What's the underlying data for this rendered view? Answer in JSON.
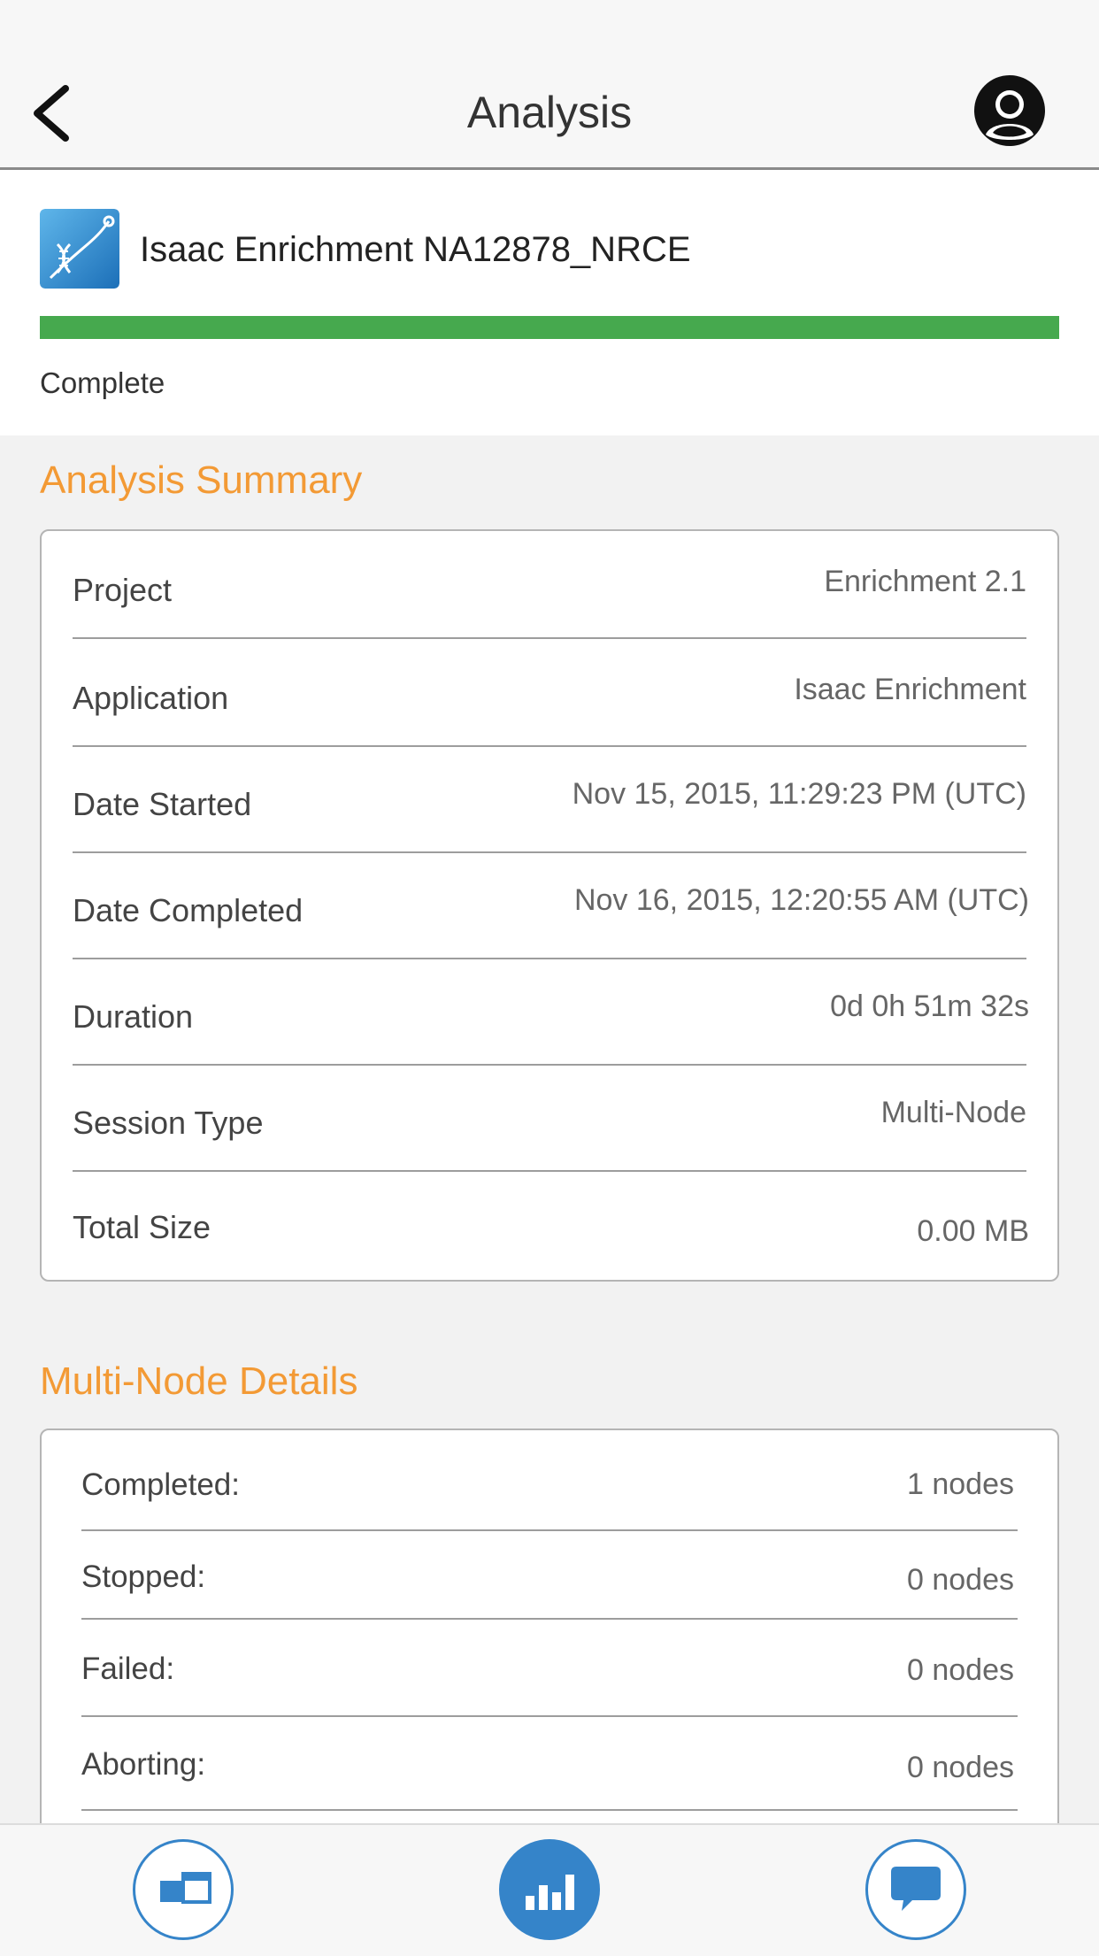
{
  "header": {
    "title": "Analysis",
    "back_icon": "chevron-left-icon",
    "avatar_icon": "user-avatar-icon"
  },
  "analysis": {
    "name": "Isaac Enrichment NA12878_NRCE",
    "status": "Complete",
    "progress_percent": 100,
    "progress_color": "#46a94e",
    "icon": "dna-app-icon"
  },
  "summary": {
    "title": "Analysis Summary",
    "rows": [
      {
        "label": "Project",
        "value": "Enrichment 2.1"
      },
      {
        "label": "Application",
        "value": "Isaac Enrichment"
      },
      {
        "label": "Date Started",
        "value": "Nov 15, 2015, 11:29:23 PM (UTC)"
      },
      {
        "label": "Date Completed",
        "value": "Nov 16, 2015, 12:20:55 AM (UTC)"
      },
      {
        "label": "Duration",
        "value": "0d 0h 51m 32s"
      },
      {
        "label": "Session Type",
        "value": "Multi-Node"
      },
      {
        "label": "Total Size",
        "value": "0.00 MB"
      }
    ]
  },
  "multinode": {
    "title": "Multi-Node Details",
    "rows": [
      {
        "label": "Completed:",
        "value": "1 nodes"
      },
      {
        "label": "Stopped:",
        "value": "0 nodes"
      },
      {
        "label": "Failed:",
        "value": "0 nodes"
      },
      {
        "label": "Aborting:",
        "value": "0 nodes"
      }
    ]
  },
  "bottom_nav": {
    "items": [
      {
        "icon": "projects-icon",
        "active": false
      },
      {
        "icon": "bar-chart-icon",
        "active": true
      },
      {
        "icon": "chat-bubble-icon",
        "active": false
      }
    ],
    "accent_color": "#3584c9"
  },
  "colors": {
    "section_title": "#f39a35",
    "accent": "#3584c9"
  }
}
